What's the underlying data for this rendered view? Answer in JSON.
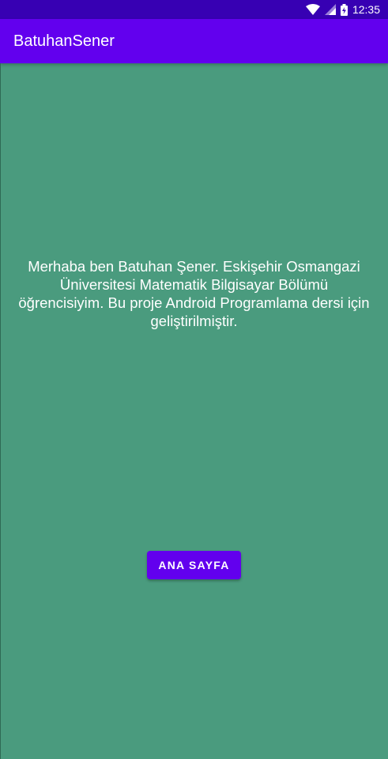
{
  "status_bar": {
    "time": "12:35",
    "icons": [
      "wifi-icon",
      "signal-icon",
      "battery-icon"
    ]
  },
  "app_bar": {
    "title": "BatuhanSener"
  },
  "main": {
    "intro_text": "Merhaba ben Batuhan Şener. Eskişehir Osmangazi Üniversitesi Matematik Bilgisayar Bölümü öğrencisiyim. Bu proje Android Programlama dersi için geliştirilmiştir.",
    "home_button_label": "ANA SAYFA"
  },
  "colors": {
    "status_bar": "#3700b3",
    "app_bar": "#6200ee",
    "background": "#4a9b7e",
    "button": "#6200ee",
    "text": "#ffffff"
  }
}
